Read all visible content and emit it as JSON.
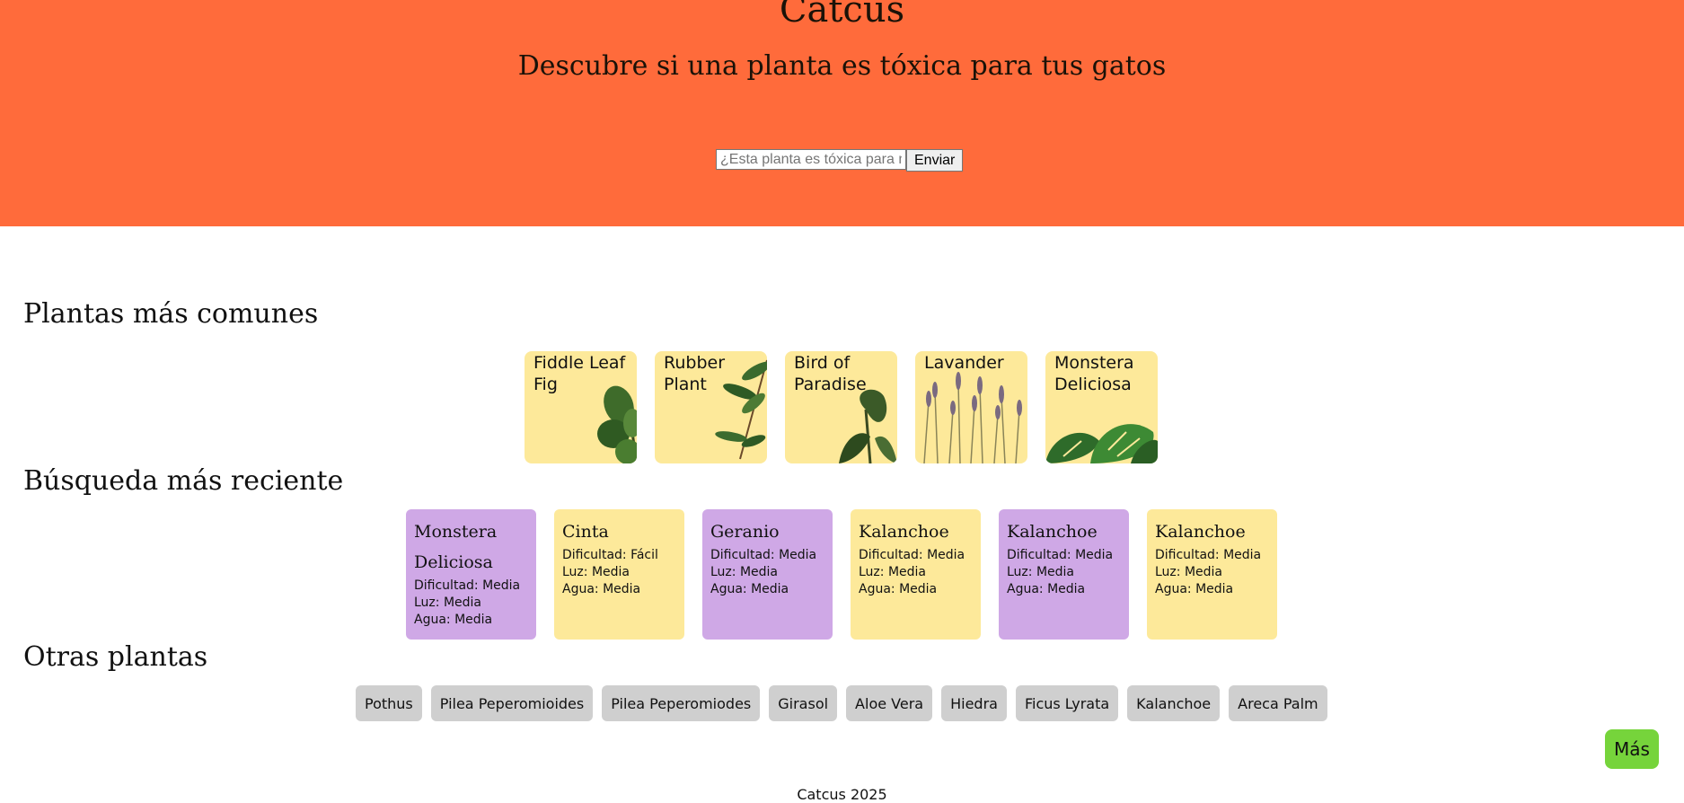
{
  "header": {
    "title": "Catcus",
    "subtitle": "Descubre si una planta es tóxica para tus gatos",
    "search_placeholder": "¿Esta planta es tóxica para mi gato?",
    "submit_label": "Enviar"
  },
  "common": {
    "title": "Plantas más comunes",
    "items": [
      {
        "label": "Fiddle Leaf Fig",
        "icon": "fiddle-leaf-fig-image"
      },
      {
        "label": "Rubber Plant",
        "icon": "rubber-plant-image"
      },
      {
        "label": "Bird of Paradise",
        "icon": "bird-of-paradise-image"
      },
      {
        "label": "Lavander",
        "icon": "lavender-image"
      },
      {
        "label": "Monstera Deliciosa",
        "icon": "monstera-image"
      }
    ]
  },
  "recent": {
    "title": "Búsqueda más reciente",
    "items": [
      {
        "name": "Monstera Deliciosa",
        "dificultad": "Dificultad: Media",
        "luz": "Luz: Media",
        "agua": "Agua: Media",
        "color": "#cfa8e6"
      },
      {
        "name": "Cinta",
        "dificultad": "Dificultad: Fácil",
        "luz": "Luz: Media",
        "agua": "Agua: Media",
        "color": "#fde99a"
      },
      {
        "name": "Geranio",
        "dificultad": "Dificultad: Media",
        "luz": "Luz: Media",
        "agua": "Agua: Media",
        "color": "#cfa8e6"
      },
      {
        "name": "Kalanchoe",
        "dificultad": "Dificultad: Media",
        "luz": "Luz: Media",
        "agua": "Agua: Media",
        "color": "#fde99a"
      },
      {
        "name": "Kalanchoe",
        "dificultad": "Dificultad: Media",
        "luz": "Luz: Media",
        "agua": "Agua: Media",
        "color": "#cfa8e6"
      },
      {
        "name": "Kalanchoe",
        "dificultad": "Dificultad: Media",
        "luz": "Luz: Media",
        "agua": "Agua: Media",
        "color": "#fde99a"
      }
    ]
  },
  "others": {
    "title": "Otras plantas",
    "items": [
      "Pothus",
      "Pilea Peperomioides",
      "Pilea Peperomiodes",
      "Girasol",
      "Aloe Vera",
      "Hiedra",
      "Ficus Lyrata",
      "Kalanchoe",
      "Areca Palm"
    ]
  },
  "more_label": "Más",
  "footer": "Catcus 2025",
  "colors": {
    "header_bg": "#ff6b3b",
    "card_yellow": "#fde99a",
    "card_purple": "#cfa8e6",
    "chip_gray": "#cfcfcf",
    "more_green": "#76d43b"
  }
}
